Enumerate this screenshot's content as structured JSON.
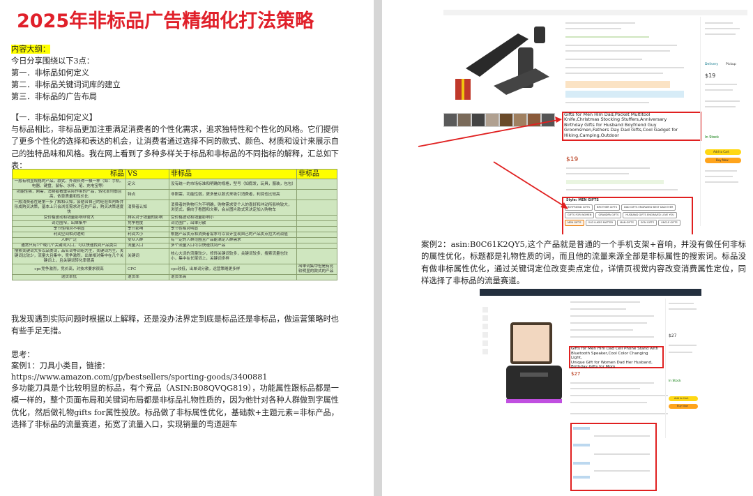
{
  "title": "2025年非标品广告精细化打法策略",
  "outline": {
    "heading": "内容大纲：",
    "intro": "今日分享围绕以下3点：",
    "items": [
      "第一．非标品如何定义",
      "第二．非标品关键词词库的建立",
      "第三．非标品的广告布局"
    ]
  },
  "section1": {
    "heading": "【一．非标品如何定义】",
    "paragraph": "与标品相比，非标品更加注重满足消费者的个性化需求，追求独特性和个性化的风格。它们提供了更多个性化的选择和表达的机会，让消费者通过选择不同的款式、颜色、材质和设计来展示自己的独特品味和风格。我在网上看到了多种多样关于标品和非标品的不同指标的解释，汇总如下表："
  },
  "table": {
    "headers": [
      "标品",
      "VS",
      "非标品",
      "非标品"
    ],
    "rows": [
      [
        "一般有明显规格的产品，款式、外观长得一模一样（如：手机、电器、键盘、鼠标、水杯、笔、充电宝等）",
        "定义",
        "没有统一的市场标准和明确的规格，型号（如假发，玩具，服装，包包）",
        ""
      ],
      [
        "功能性强，刚需，消费者看重实际作用的产品，转化率均衡且高，依靠质量和性价比",
        "特点",
        "非刚需，功能性弱，更多是以款式来吸引消费者，利润也比较高",
        ""
      ],
      [
        "一般消费者在是第一步了解和认知，会结合自己的经验去判断并形成购买决策，基本上只会浏览需求对应的产品，购买决策速度快",
        "消费者认知",
        "消费者的购物行为不明确，购物需求受个人的喜好和冲动所影响较大，浏览式，偏向于看图和文案，会从图片款式来决定加入购物车",
        ""
      ],
      [
        "受价格波动和销量影响非常大",
        "排名对于销量的影响",
        "受价格波动和销量影响小",
        ""
      ],
      [
        "词范围窄，出单集中",
        "竞争程度",
        "词范围广，出单分散",
        ""
      ],
      [
        "季节性相对不明显",
        "季节影响",
        "季节性相对明显",
        ""
      ],
      [
        "利润空间相对透明",
        "利润大小",
        "根据产品卖点和消费者需求可以设计呈现自己的产品卖点拉大利润值",
        ""
      ],
      [
        "人群广泛",
        "受众人群",
        "有一定的人群范围且产品能满足人群需求",
        ""
      ],
      [
        "通常只有1个或几个关键词入口，可以快速找到产品类目",
        "流量入口",
        "多个流量入口可以快速找到产品",
        ""
      ],
      [
        "搜索关键词大多以品类词，品名词等词组为主，关键词为主，关键词比较少，流量大且集中，竞争激烈，出单相对集中在几个关键词上，且关键词转化率很高",
        "关键词",
        "核心大词的流量较少，修饰关键词较多，关键词较多，搜索流量也较小，集中在长尾词上，关键词多样",
        ""
      ],
      [
        "cpc竞争激烈，竞价高，对技术要求很高",
        "CPC",
        "cpc较低，出单词分散，运营策略更多样",
        "出单词集中但是有比较明显的款式的产品"
      ],
      [
        "退货率低",
        "退货率",
        "退货率高",
        ""
      ]
    ]
  },
  "after_table": "我发现遇到实际问题时根据以上解释，还是没办法界定到底是标品还是非标品，做运营策略时也有些手足无措。",
  "thinking": {
    "label": "思考：",
    "case1_label": "案例1：刀具小类目，链接：",
    "case1_link": "https://www.amazon.com/gp/bestsellers/sporting-goods/3400881",
    "case1_body": "多功能刀具是个比较明显的标品，有个竞品（ASIN:B08QVQG819），功能属性跟标品都是一模一样的，整个页面布局和关键词布局都是非标品礼物性质的，因为他针对各种人群做到字属性优化，然后做礼物gifts for属性投放。标品做了非标属性优化，基础款+主题元素=非标产品，选择了非标品的流量赛道，拓宽了流量入口，实现销量的弯道超车"
  },
  "case2": "案例2：asin:B0C61K2QY5,这个产品就是普通的一个手机支架+音响，并没有做任何非标的属性优化，标题都是礼物性质的词，而且他的流量来源全部是非标属性的搜索词。标品没有做非标属性优化，通过关键词定位改变卖点定位，详情页视觉内容改变消费属性定位，同样选择了非标品的流量赛道。",
  "shot1": {
    "title_lines": [
      "Gifts for Men Him Dad,Pocket Multitool",
      "Knife,Christmas Stocking Stuffers,Anniversary",
      "Birthday Gifts for Husband Boyfriend Guy",
      "Groomsmen,Fathers Day Dad Gifts,Cool Gadget for",
      "Hiking,Camping,Outdoor"
    ],
    "price": "$19",
    "style_label": "Style: MEN GIFTS",
    "style_options": [
      "BOYFRIEND GIFTS",
      "BROTHER GIFTS",
      "DAD GIFTS ENGRAVED BEST DAD EVER",
      "GIFTS FOR WOMEN",
      "GRANDPA GIFTS",
      "HUSBAND GIFTS ENGRAVED LOVE YOU",
      "MEN GIFTS",
      "OLD LUKES MATTER",
      "MAN GIFTS",
      "SON GIFTS",
      "UNCLE GIFTS"
    ],
    "buy_price": "$19",
    "add_to_cart": "Add to Cart",
    "buy_now": "Buy Now",
    "in_stock": "In Stock",
    "delivery_tab": "Delivery",
    "pickup_tab": "Pickup"
  },
  "shot2": {
    "title_lines": [
      "Gifts for Men Him Dad Cell Phone Stand with",
      "Bluetooth Speaker,Cool Color Changing Light,",
      "Unique Gift for Women Dad Her Husband,",
      "Birthday Gifts for Mom"
    ],
    "price": "$27",
    "buy_price": "$27",
    "in_stock": "In Stock",
    "add_to_cart": "Add to Cart",
    "buy_now": "Buy Now"
  },
  "colors": {
    "title_red": "#e0202a",
    "highlight": "#ffff00",
    "table_green": "#cfe6bf",
    "annotation_red": "#e02020"
  }
}
